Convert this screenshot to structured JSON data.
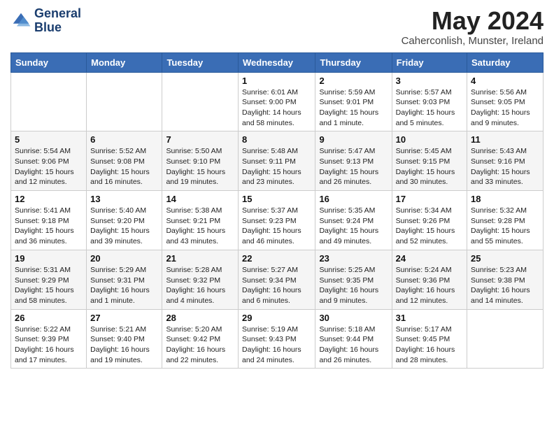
{
  "header": {
    "logo_line1": "General",
    "logo_line2": "Blue",
    "month_title": "May 2024",
    "location": "Caherconlish, Munster, Ireland"
  },
  "days_of_week": [
    "Sunday",
    "Monday",
    "Tuesday",
    "Wednesday",
    "Thursday",
    "Friday",
    "Saturday"
  ],
  "weeks": [
    [
      {
        "num": "",
        "info": ""
      },
      {
        "num": "",
        "info": ""
      },
      {
        "num": "",
        "info": ""
      },
      {
        "num": "1",
        "info": "Sunrise: 6:01 AM\nSunset: 9:00 PM\nDaylight: 14 hours\nand 58 minutes."
      },
      {
        "num": "2",
        "info": "Sunrise: 5:59 AM\nSunset: 9:01 PM\nDaylight: 15 hours\nand 1 minute."
      },
      {
        "num": "3",
        "info": "Sunrise: 5:57 AM\nSunset: 9:03 PM\nDaylight: 15 hours\nand 5 minutes."
      },
      {
        "num": "4",
        "info": "Sunrise: 5:56 AM\nSunset: 9:05 PM\nDaylight: 15 hours\nand 9 minutes."
      }
    ],
    [
      {
        "num": "5",
        "info": "Sunrise: 5:54 AM\nSunset: 9:06 PM\nDaylight: 15 hours\nand 12 minutes."
      },
      {
        "num": "6",
        "info": "Sunrise: 5:52 AM\nSunset: 9:08 PM\nDaylight: 15 hours\nand 16 minutes."
      },
      {
        "num": "7",
        "info": "Sunrise: 5:50 AM\nSunset: 9:10 PM\nDaylight: 15 hours\nand 19 minutes."
      },
      {
        "num": "8",
        "info": "Sunrise: 5:48 AM\nSunset: 9:11 PM\nDaylight: 15 hours\nand 23 minutes."
      },
      {
        "num": "9",
        "info": "Sunrise: 5:47 AM\nSunset: 9:13 PM\nDaylight: 15 hours\nand 26 minutes."
      },
      {
        "num": "10",
        "info": "Sunrise: 5:45 AM\nSunset: 9:15 PM\nDaylight: 15 hours\nand 30 minutes."
      },
      {
        "num": "11",
        "info": "Sunrise: 5:43 AM\nSunset: 9:16 PM\nDaylight: 15 hours\nand 33 minutes."
      }
    ],
    [
      {
        "num": "12",
        "info": "Sunrise: 5:41 AM\nSunset: 9:18 PM\nDaylight: 15 hours\nand 36 minutes."
      },
      {
        "num": "13",
        "info": "Sunrise: 5:40 AM\nSunset: 9:20 PM\nDaylight: 15 hours\nand 39 minutes."
      },
      {
        "num": "14",
        "info": "Sunrise: 5:38 AM\nSunset: 9:21 PM\nDaylight: 15 hours\nand 43 minutes."
      },
      {
        "num": "15",
        "info": "Sunrise: 5:37 AM\nSunset: 9:23 PM\nDaylight: 15 hours\nand 46 minutes."
      },
      {
        "num": "16",
        "info": "Sunrise: 5:35 AM\nSunset: 9:24 PM\nDaylight: 15 hours\nand 49 minutes."
      },
      {
        "num": "17",
        "info": "Sunrise: 5:34 AM\nSunset: 9:26 PM\nDaylight: 15 hours\nand 52 minutes."
      },
      {
        "num": "18",
        "info": "Sunrise: 5:32 AM\nSunset: 9:28 PM\nDaylight: 15 hours\nand 55 minutes."
      }
    ],
    [
      {
        "num": "19",
        "info": "Sunrise: 5:31 AM\nSunset: 9:29 PM\nDaylight: 15 hours\nand 58 minutes."
      },
      {
        "num": "20",
        "info": "Sunrise: 5:29 AM\nSunset: 9:31 PM\nDaylight: 16 hours\nand 1 minute."
      },
      {
        "num": "21",
        "info": "Sunrise: 5:28 AM\nSunset: 9:32 PM\nDaylight: 16 hours\nand 4 minutes."
      },
      {
        "num": "22",
        "info": "Sunrise: 5:27 AM\nSunset: 9:34 PM\nDaylight: 16 hours\nand 6 minutes."
      },
      {
        "num": "23",
        "info": "Sunrise: 5:25 AM\nSunset: 9:35 PM\nDaylight: 16 hours\nand 9 minutes."
      },
      {
        "num": "24",
        "info": "Sunrise: 5:24 AM\nSunset: 9:36 PM\nDaylight: 16 hours\nand 12 minutes."
      },
      {
        "num": "25",
        "info": "Sunrise: 5:23 AM\nSunset: 9:38 PM\nDaylight: 16 hours\nand 14 minutes."
      }
    ],
    [
      {
        "num": "26",
        "info": "Sunrise: 5:22 AM\nSunset: 9:39 PM\nDaylight: 16 hours\nand 17 minutes."
      },
      {
        "num": "27",
        "info": "Sunrise: 5:21 AM\nSunset: 9:40 PM\nDaylight: 16 hours\nand 19 minutes."
      },
      {
        "num": "28",
        "info": "Sunrise: 5:20 AM\nSunset: 9:42 PM\nDaylight: 16 hours\nand 22 minutes."
      },
      {
        "num": "29",
        "info": "Sunrise: 5:19 AM\nSunset: 9:43 PM\nDaylight: 16 hours\nand 24 minutes."
      },
      {
        "num": "30",
        "info": "Sunrise: 5:18 AM\nSunset: 9:44 PM\nDaylight: 16 hours\nand 26 minutes."
      },
      {
        "num": "31",
        "info": "Sunrise: 5:17 AM\nSunset: 9:45 PM\nDaylight: 16 hours\nand 28 minutes."
      },
      {
        "num": "",
        "info": ""
      }
    ]
  ]
}
